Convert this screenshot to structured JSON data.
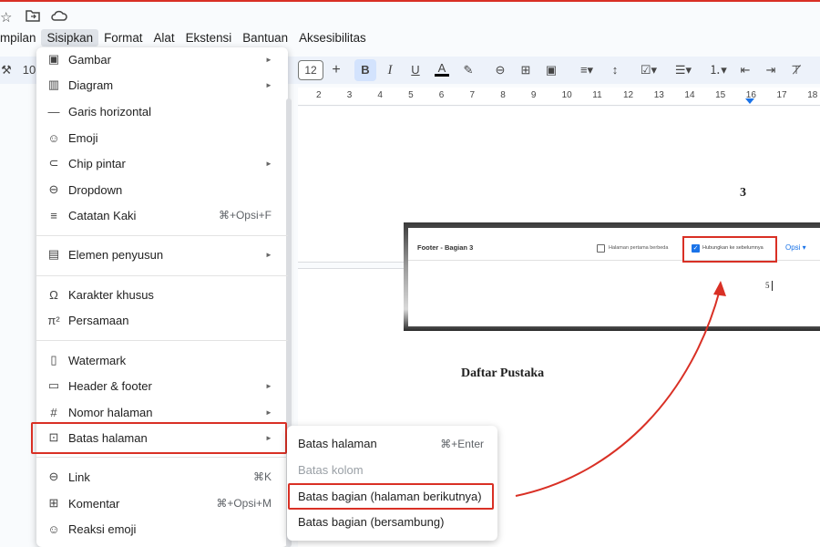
{
  "window": {
    "icons": [
      "star-icon",
      "folder-move-icon",
      "cloud-icon"
    ]
  },
  "menubar": [
    "mpilan",
    "Sisipkan",
    "Format",
    "Alat",
    "Ekstensi",
    "Bantuan",
    "Aksesibilitas"
  ],
  "toolbar": {
    "zoom_partial": "10",
    "font_size": "12",
    "plus": "+",
    "bold": "B",
    "italic": "I",
    "underline": "U",
    "text_color": "A"
  },
  "ruler": [
    "2",
    "3",
    "4",
    "5",
    "6",
    "7",
    "8",
    "9",
    "10",
    "11",
    "12",
    "13",
    "14",
    "15",
    "16",
    "17",
    "18"
  ],
  "document": {
    "page_number": "3",
    "heading": "Daftar Pustaka"
  },
  "inset": {
    "section_label": "Footer - Bagian 3",
    "checkbox1_label": "Halaman pertama berbeda",
    "checkbox2_label": "Hubungkan ke sebelumnya",
    "checkbox2_checked": true,
    "options": "Opsi ▾",
    "footer_number": "5"
  },
  "menu": {
    "items": [
      {
        "label": "Gambar",
        "icon": "image-icon",
        "has_submenu": true
      },
      {
        "label": "Diagram",
        "icon": "chart-icon",
        "has_submenu": true
      },
      {
        "label": "Garis horizontal",
        "icon": "horizontal-line-icon"
      },
      {
        "label": "Emoji",
        "icon": "emoji-icon"
      },
      {
        "label": "Chip pintar",
        "icon": "smart-chip-icon",
        "has_submenu": true
      },
      {
        "label": "Dropdown",
        "icon": "dropdown-icon"
      },
      {
        "label": "Catatan Kaki",
        "icon": "footnote-icon",
        "shortcut": "⌘+Opsi+F"
      },
      {
        "label": "Elemen penyusun",
        "icon": "building-blocks-icon",
        "has_submenu": true
      },
      {
        "label": "Karakter khusus",
        "icon": "omega-icon"
      },
      {
        "label": "Persamaan",
        "icon": "pi-icon"
      },
      {
        "label": "Watermark",
        "icon": "watermark-icon"
      },
      {
        "label": "Header & footer",
        "icon": "header-footer-icon",
        "has_submenu": true
      },
      {
        "label": "Nomor halaman",
        "icon": "hash-icon",
        "has_submenu": true
      },
      {
        "label": "Batas halaman",
        "icon": "page-break-icon",
        "has_submenu": true
      },
      {
        "label": "Link",
        "icon": "link-icon",
        "shortcut": "⌘K"
      },
      {
        "label": "Komentar",
        "icon": "comment-icon",
        "shortcut": "⌘+Opsi+M"
      },
      {
        "label": "Reaksi emoji",
        "icon": "emoji-reaction-icon"
      }
    ]
  },
  "submenu": {
    "items": [
      {
        "label": "Batas halaman",
        "shortcut": "⌘+Enter",
        "disabled": false
      },
      {
        "label": "Batas kolom",
        "disabled": true
      },
      {
        "label": "Batas bagian (halaman berikutnya)",
        "disabled": false
      },
      {
        "label": "Batas bagian (bersambung)",
        "disabled": false
      }
    ]
  },
  "colors": {
    "highlight": "#d93025",
    "accent": "#1a73e8"
  }
}
